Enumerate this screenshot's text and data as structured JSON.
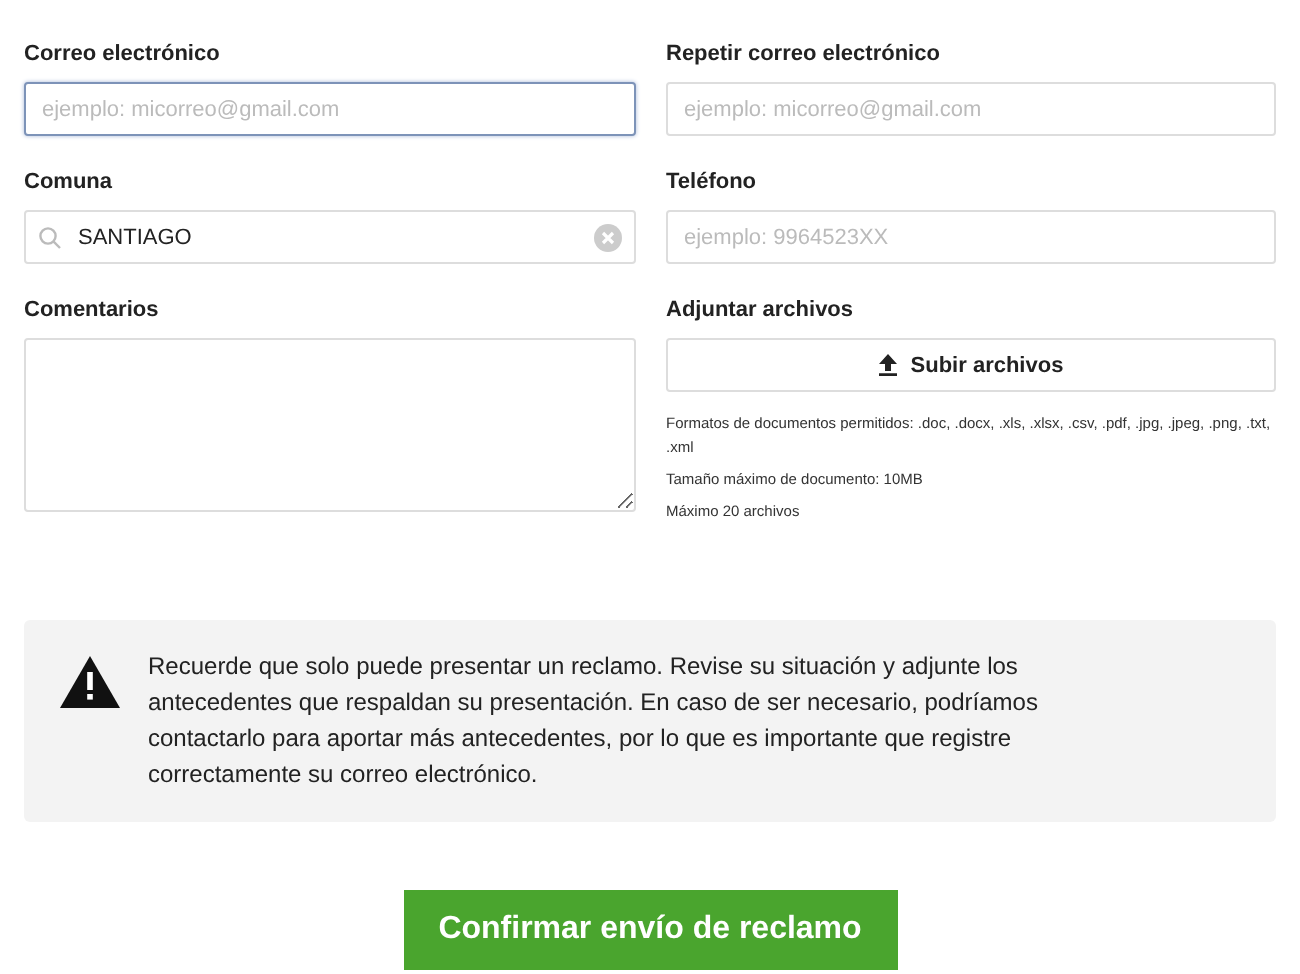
{
  "fields": [
    {
      "kind": "text",
      "label": "Correo electrónico",
      "placeholder": "ejemplo: micorreo@gmail.com",
      "focused": true
    },
    {
      "kind": "text",
      "label": "Repetir correo electrónico",
      "placeholder": "ejemplo: micorreo@gmail.com",
      "focused": false
    },
    {
      "kind": "search",
      "label": "Comuna",
      "value": "SANTIAGO",
      "focused": false
    },
    {
      "kind": "text",
      "label": "Teléfono",
      "placeholder": "ejemplo: 9964523XX",
      "focused": false
    },
    {
      "kind": "textarea",
      "label": "Comentarios",
      "focused": false
    },
    {
      "kind": "upload",
      "label": "Adjuntar archivos",
      "button": "Subir archivos",
      "notes": [
        "Formatos de documentos permitidos: .doc, .docx, .xls, .xlsx, .csv, .pdf, .jpg, .jpeg, .png, .txt, .xml",
        "Tamaño máximo de documento: 10MB",
        "Máximo 20 archivos"
      ]
    }
  ],
  "notice": {
    "text": "Recuerde que solo puede presentar un reclamo. Revise su situación y adjunte los antecedentes que respaldan su presentación. En caso de ser necesario, podríamos contactarlo para aportar más antecedentes, por lo que es importante que registre correctamente su correo electrónico."
  },
  "submit": {
    "label": "Confirmar envío de reclamo"
  }
}
